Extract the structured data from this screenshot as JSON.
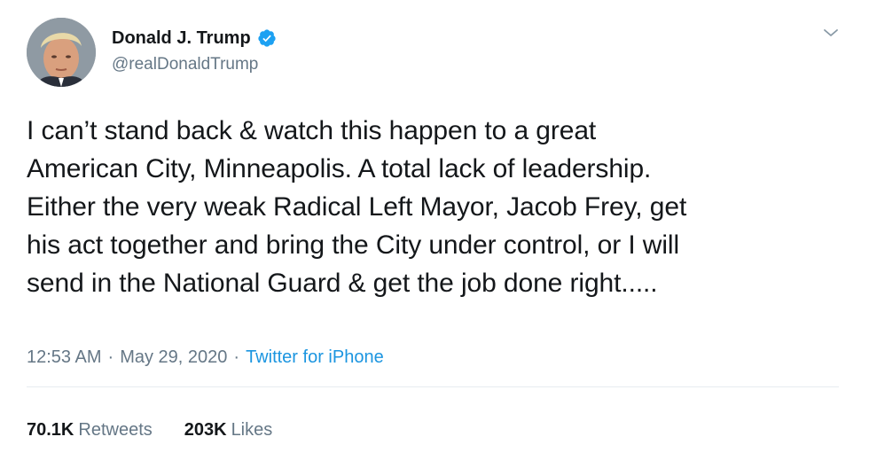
{
  "author": {
    "display_name": "Donald J. Trump",
    "handle": "@realDonaldTrump",
    "verified_icon": "verified-badge-icon",
    "avatar_icon": "avatar-photo"
  },
  "menu": {
    "icon": "chevron-down-icon"
  },
  "tweet": {
    "lines": [
      "I can’t stand back & watch this happen to a great",
      "American City, Minneapolis. A total lack of leadership.",
      "Either the very weak Radical Left Mayor, Jacob Frey, get",
      "his act together and bring the City under control, or I will",
      "send in the National Guard & get the job done right....."
    ]
  },
  "meta": {
    "time": "12:53 AM",
    "separator": "·",
    "date": "May 29, 2020",
    "source": "Twitter for iPhone"
  },
  "stats": {
    "retweets_count": "70.1K",
    "retweets_label": "Retweets",
    "likes_count": "203K",
    "likes_label": "Likes"
  },
  "colors": {
    "text": "#14171a",
    "secondary": "#657786",
    "link": "#1b95e0",
    "verified": "#1da1f2",
    "divider": "#e6ecf0"
  }
}
